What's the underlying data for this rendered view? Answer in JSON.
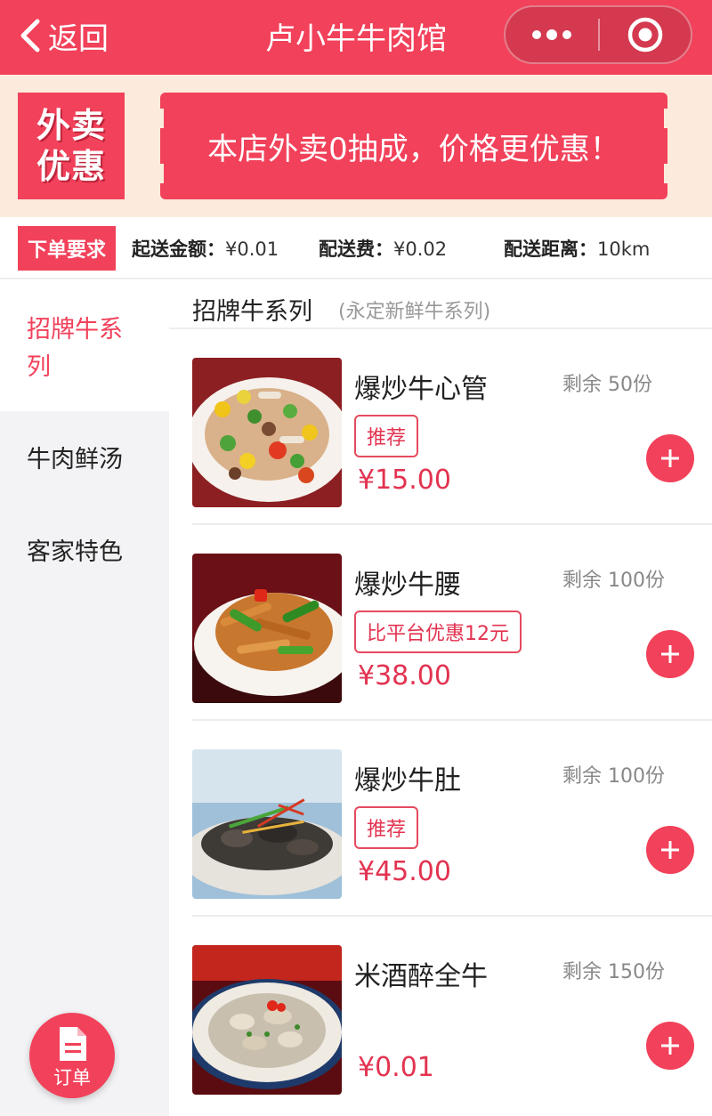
{
  "header": {
    "back_label": "返回",
    "title": "卢小牛牛肉馆",
    "icons": [
      "chevron-left-icon",
      "more-dots-icon",
      "target-record-icon"
    ]
  },
  "promo": {
    "badge_line1": "外卖",
    "badge_line2": "优惠",
    "message": "本店外卖0抽成，价格更优惠！"
  },
  "requirements": {
    "badge": "下单要求",
    "min_order_label": "起送金额：",
    "min_order_value": "¥0.01",
    "delivery_fee_label": "配送费：",
    "delivery_fee_value": "¥0.02",
    "distance_label": "配送距离：",
    "distance_value": "10km"
  },
  "sidebar": {
    "items": [
      {
        "label": "招牌牛系列",
        "active": true
      },
      {
        "label": "牛肉鲜汤",
        "active": false
      },
      {
        "label": "客家特色",
        "active": false
      }
    ],
    "order_button_label": "订单"
  },
  "category": {
    "title": "招牌牛系列",
    "subtitle": "(永定新鲜牛系列)"
  },
  "dishes": [
    {
      "name": "爆炒牛心管",
      "stock": "剩余 50份",
      "tag": "推荐",
      "price": "¥15.00"
    },
    {
      "name": "爆炒牛腰",
      "stock": "剩余 100份",
      "tag": "比平台优惠12元",
      "price": "¥38.00"
    },
    {
      "name": "爆炒牛肚",
      "stock": "剩余 100份",
      "tag": "推荐",
      "price": "¥45.00"
    },
    {
      "name": "米酒醉全牛",
      "stock": "剩余 150份",
      "tag": "",
      "price": "¥0.01"
    }
  ],
  "colors": {
    "accent": "#f2415a",
    "promo_background": "#fcebdc",
    "sidebar_background": "#f3f3f5",
    "price": "#e23350"
  }
}
